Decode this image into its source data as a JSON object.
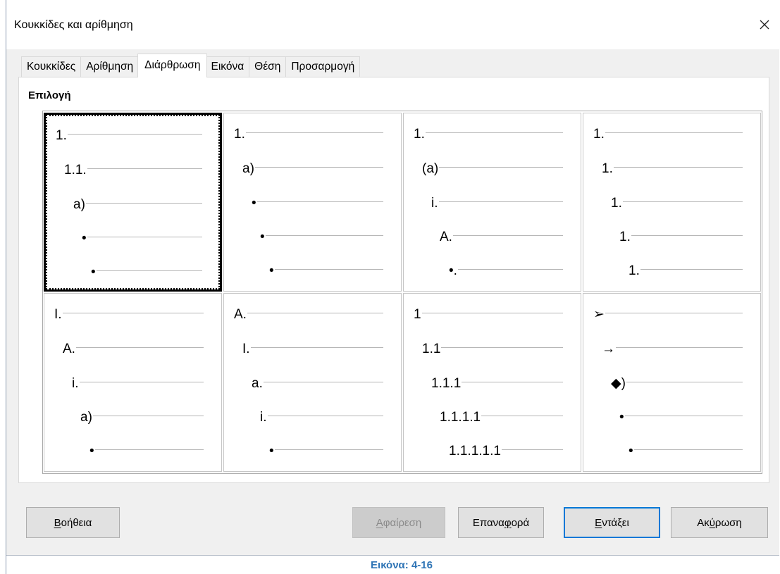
{
  "window": {
    "title": "Κουκκίδες και αρίθμηση",
    "close_icon": "close-icon"
  },
  "tabs": [
    {
      "label": "Κουκκίδες",
      "active": false
    },
    {
      "label": "Αρίθμηση",
      "active": false
    },
    {
      "label": "Διάρθρωση",
      "active": true
    },
    {
      "label": "Εικόνα",
      "active": false
    },
    {
      "label": "Θέση",
      "active": false
    },
    {
      "label": "Προσαρμογή",
      "active": false
    }
  ],
  "selection": {
    "heading": "Επιλογή",
    "presets": [
      {
        "selected": true,
        "levels": [
          "1.",
          "1.1.",
          "a)",
          "•",
          "•"
        ]
      },
      {
        "selected": false,
        "levels": [
          "1.",
          "a)",
          "•",
          "•",
          "•"
        ]
      },
      {
        "selected": false,
        "levels": [
          "1.",
          "(a)",
          "i.",
          "A.",
          "•."
        ]
      },
      {
        "selected": false,
        "levels": [
          "1.",
          "1.",
          "1.",
          "1.",
          "1."
        ]
      },
      {
        "selected": false,
        "levels": [
          "I.",
          "A.",
          "i.",
          "a)",
          "•"
        ]
      },
      {
        "selected": false,
        "levels": [
          "A.",
          "I.",
          "a.",
          "i.",
          "•"
        ]
      },
      {
        "selected": false,
        "levels": [
          "1",
          "1.1",
          "1.1.1",
          "1.1.1.1",
          "1.1.1.1.1"
        ]
      },
      {
        "selected": false,
        "levels": [
          "➢",
          "→",
          "◆)",
          "•",
          "•"
        ]
      }
    ]
  },
  "buttons": {
    "help": {
      "label": "Βοήθεια",
      "access_key_index": 0
    },
    "remove": {
      "label": "Αφαίρεση",
      "access_key_index": 0,
      "disabled": true
    },
    "reset": {
      "label": "Επαναφορά",
      "access_key_index": 5
    },
    "ok": {
      "label": "Εντάξει",
      "access_key_index": 0,
      "is_default": true
    },
    "cancel": {
      "label": "Ακύρωση",
      "access_key_index": 2
    }
  },
  "caption": "Εικόνα: 4-16",
  "colors": {
    "default_button_border": "#0078d7",
    "caption": "#2e74b5",
    "selection_frame": "#000000",
    "dialog_background": "#f0f0f0"
  }
}
